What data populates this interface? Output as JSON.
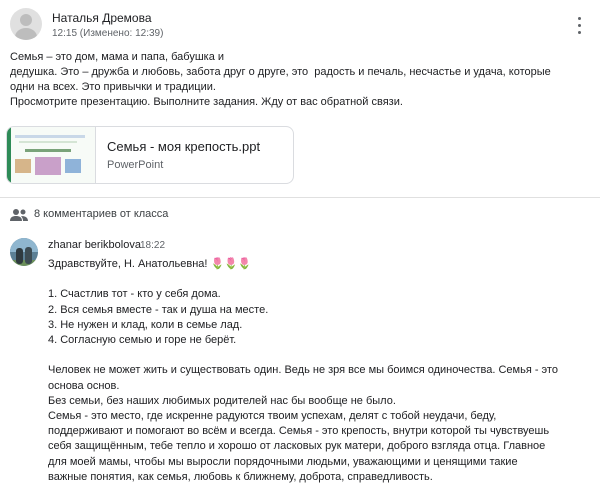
{
  "post": {
    "author": "Наталья Дремова",
    "meta": "12:15 (Изменено: 12:39)",
    "body_lines": [
      "Семья – это дом, мама и папа, бабушка и",
      "дедушка. Это – дружба и любовь, забота друг о друге, это  радость и печаль, несчастье и удача, которые",
      "одни на всех. Это привычки и традиции.",
      "Просмотрите презентацию. Выполните задания. Жду от вас обратной связи."
    ],
    "attachment": {
      "title": "Семья - моя крепость.ppt",
      "type": "PowerPoint"
    }
  },
  "comments": {
    "header": "8 комментариев от класса",
    "items": [
      {
        "author": "zhanar berikbolova",
        "time": "18:22",
        "lines": [
          "Здравствуйте, Н. Анатольевна! 🌷🌷🌷",
          "",
          "1. Счастлив тот - кто у себя дома.",
          "2. Вся семья вместе - так и душа на месте.",
          "3. Не нужен и клад, коли в семье лад.",
          "4. Согласную семью и горе не берёт.",
          "",
          "Человек не может жить и существовать один. Ведь не зря все мы боимся одиночества. Семья - это",
          "основа основ.",
          "Без семьи, без наших любимых родителей нас бы вообще не было.",
          "Семья - это место, где искренне радуются твоим успехам, делят с тобой неудачи, беду,",
          "поддерживают и помогают во всём и всегда. Семья - это крепость, внутри которой ты чувствуешь",
          "себя защищённым, тебе тепло и хорошо от ласковых рук матери, доброго взгляда отца. Главное",
          "для моей мамы, чтобы мы выросли порядочными людьми, уважающими и ценящими такие",
          "важные понятия, как семья, любовь к ближнему, доброта, справедливость."
        ]
      }
    ]
  },
  "icons": {
    "more": "more-vert-icon",
    "people": "people-icon",
    "profile": "profile-icon"
  },
  "colors": {
    "text": "#202124",
    "muted": "#5f6368",
    "border": "#dadce0"
  }
}
